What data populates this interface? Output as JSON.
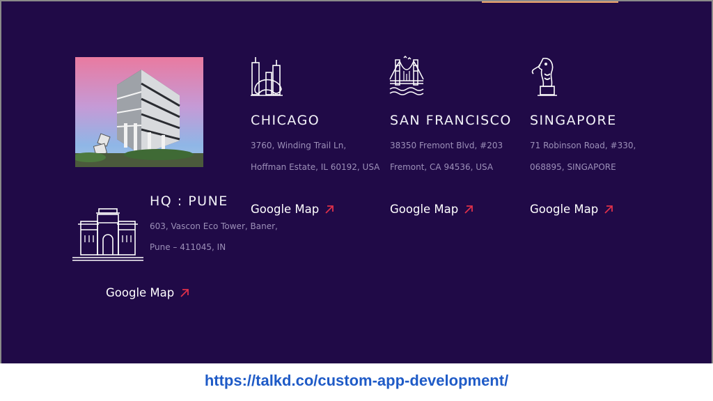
{
  "offices": {
    "hq": {
      "title": "HQ : PUNE",
      "address_line1": "603, Vascon Eco Tower, Baner,",
      "address_line2": "Pune – 411045, IN",
      "map_label": "Google Map",
      "icon": "palace-icon"
    },
    "chicago": {
      "title": "CHICAGO",
      "address_line1": "3760, Winding Trail Ln,",
      "address_line2": "Hoffman Estate, IL 60192, USA",
      "map_label": "Google Map",
      "icon": "chicago-skyline-icon"
    },
    "san_francisco": {
      "title": "SAN FRANCISCO",
      "address_line1": "38350 Fremont Blvd, #203",
      "address_line2": "Fremont, CA 94536, USA",
      "map_label": "Google Map",
      "icon": "golden-gate-bridge-icon"
    },
    "singapore": {
      "title": "SINGAPORE",
      "address_line1": "71 Robinson Road, #330,",
      "address_line2": "068895, SINGAPORE",
      "map_label": "Google Map",
      "icon": "merlion-icon"
    }
  },
  "footer": {
    "url": "https://talkd.co/custom-app-development/"
  },
  "colors": {
    "background": "#200a47",
    "title": "#f2f2f8",
    "address": "#9c90b8",
    "arrow": "#e0304a",
    "link": "#1f5bc7",
    "top_accent": "#f0a56b"
  }
}
